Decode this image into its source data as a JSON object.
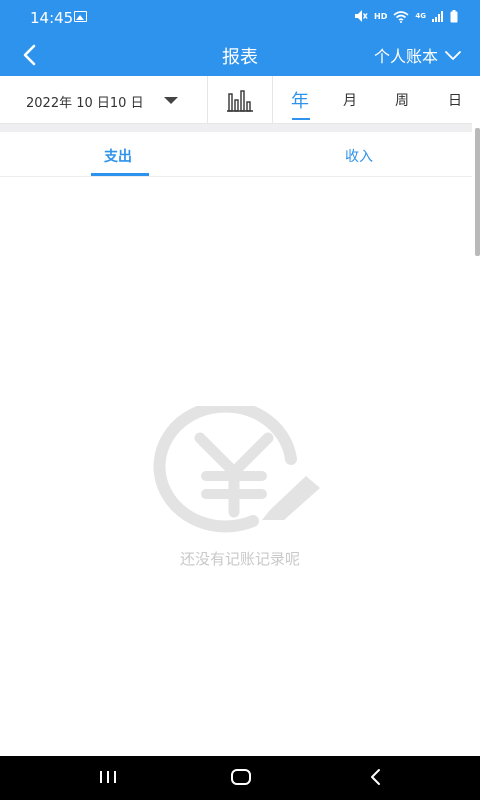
{
  "status_bar": {
    "time": "14:45",
    "hd_label": "HD",
    "network_label": "4G",
    "icons": [
      "gallery-icon",
      "mute-icon",
      "wifi-icon",
      "signal-icon",
      "battery-icon"
    ]
  },
  "header": {
    "title": "报表",
    "account_label": "个人账本"
  },
  "filters": {
    "date_label": "2022年 10 日10 日",
    "periods": [
      {
        "label": "年",
        "active": true
      },
      {
        "label": "月",
        "active": false
      },
      {
        "label": "周",
        "active": false
      },
      {
        "label": "日",
        "active": false
      }
    ]
  },
  "tabs": [
    {
      "label": "支出",
      "active": true
    },
    {
      "label": "收入",
      "active": false
    }
  ],
  "empty_state": {
    "message": "还没有记账记录呢",
    "icon": "yen-edit-icon"
  },
  "colors": {
    "accent": "#2e93ec",
    "empty_gray": "#e3e3e3"
  }
}
